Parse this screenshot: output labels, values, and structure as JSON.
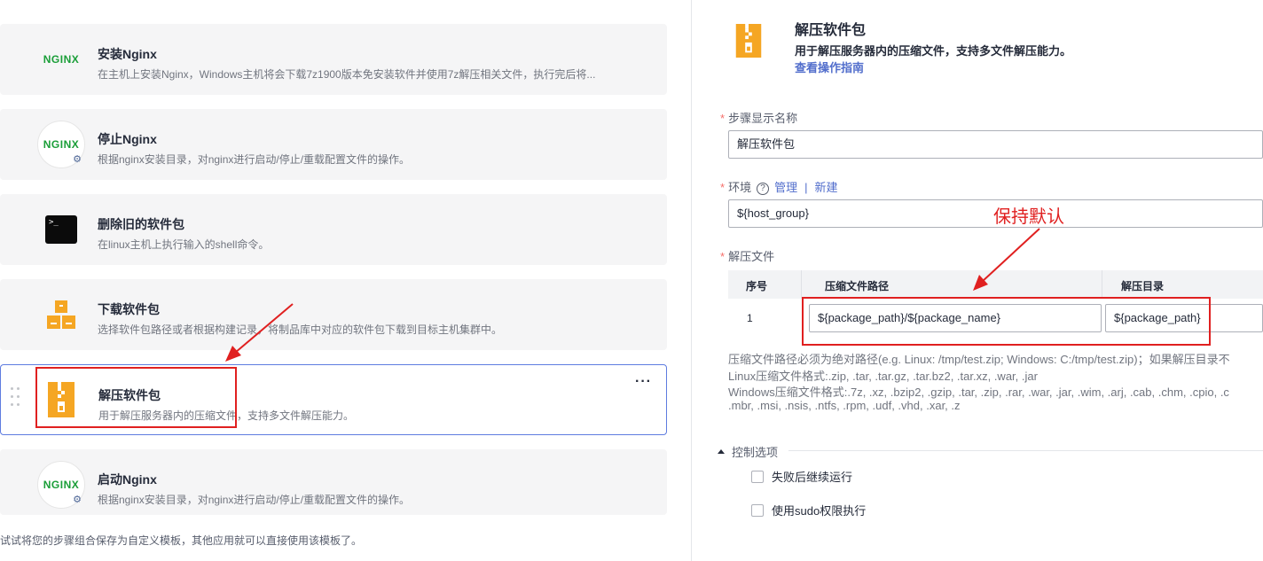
{
  "steps": [
    {
      "title": "安装Nginx",
      "desc": "在主机上安装Nginx，Windows主机将会下载7z1900版本免安装软件并使用7z解压相关文件，执行完后将...",
      "icon": "nginx-icon"
    },
    {
      "title": "停止Nginx",
      "desc": "根据nginx安装目录，对nginx进行启动/停止/重载配置文件的操作。",
      "icon": "nginx-icon"
    },
    {
      "title": "删除旧的软件包",
      "desc": "在linux主机上执行输入的shell命令。",
      "icon": "terminal-icon"
    },
    {
      "title": "下载软件包",
      "desc": "选择软件包路径或者根据构建记录，将制品库中对应的软件包下载到目标主机集群中。",
      "icon": "boxes-icon"
    },
    {
      "title": "解压软件包",
      "desc": "用于解压服务器内的压缩文件，支持多文件解压能力。",
      "icon": "zip-icon"
    },
    {
      "title": "启动Nginx",
      "desc": "根据nginx安装目录，对nginx进行启动/停止/重载配置文件的操作。",
      "icon": "nginx-icon"
    }
  ],
  "nginx_logo_text": "NGINX",
  "terminal_prompt": ">_",
  "more_label": "···",
  "footer_tip": "试试将您的步骤组合保存为自定义模板，其他应用就可以直接使用该模板了。",
  "panel": {
    "title": "解压软件包",
    "desc": "用于解压服务器内的压缩文件，支持多文件解压能力。",
    "guide_link": "查看操作指南",
    "required_mark": "*",
    "step_name_label": "步骤显示名称",
    "step_name_value": "解压软件包",
    "env_label": "环境",
    "env_help": "?",
    "env_manage": "管理",
    "env_sep": "|",
    "env_new": "新建",
    "env_value": "${host_group}",
    "unzip_label": "解压文件",
    "table": {
      "col_no": "序号",
      "col_path": "压缩文件路径",
      "col_dir": "解压目录",
      "rows": [
        {
          "no": "1",
          "path": "${package_path}/${package_name}",
          "dir": "${package_path}"
        }
      ]
    },
    "hints": [
      "压缩文件路径必须为绝对路径(e.g. Linux: /tmp/test.zip; Windows: C:/tmp/test.zip)；如果解压目录不",
      "Linux压缩文件格式:.zip, .tar, .tar.gz, .tar.bz2, .tar.xz, .war, .jar",
      "Windows压缩文件格式:.7z, .xz, .bzip2, .gzip, .tar, .zip, .rar, .war, .jar, .wim, .arj, .cab, .chm, .cpio, .c",
      ".mbr, .msi, .nsis, .ntfs, .rpm, .udf, .vhd, .xar, .z"
    ],
    "control_title": "控制选项",
    "options": [
      "失败后继续运行",
      "使用sudo权限执行"
    ]
  },
  "annotation": "保持默认",
  "colors": {
    "accent": "#5e7ce0",
    "link": "#526ecc",
    "annotation": "#e02020",
    "nginx": "#1a9e38",
    "zip": "#f5a623"
  }
}
